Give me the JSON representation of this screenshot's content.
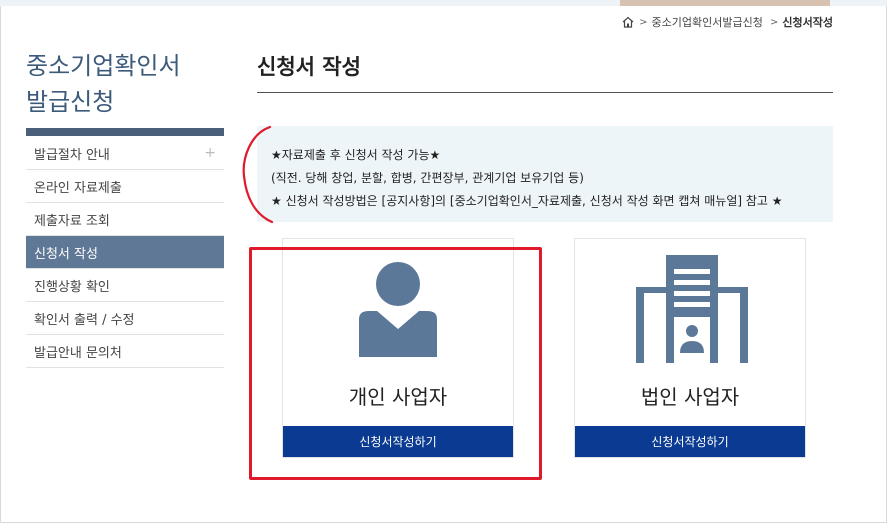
{
  "breadcrumb": {
    "items": [
      "중소기업확인서발급신청",
      "신청서작성"
    ]
  },
  "sidebar": {
    "title_line1": "중소기업확인서",
    "title_line2": "발급신청",
    "items": [
      {
        "label": "발급절차 안내",
        "expand": "+"
      },
      {
        "label": "온라인 자료제출"
      },
      {
        "label": "제출자료 조회"
      },
      {
        "label": "신청서 작성",
        "active": true
      },
      {
        "label": "진행상황 확인"
      },
      {
        "label": "확인서 출력 / 수정"
      },
      {
        "label": "발급안내 문의처"
      }
    ]
  },
  "main": {
    "title": "신청서 작성",
    "notice": {
      "line1": "★자료제출 후 신청서 작성 가능★",
      "line2": "(직전. 당해 창업, 분할, 합병, 간편장부, 관계기업 보유기업 등)",
      "line3": "★ 신청서 작성방법은 [공지사항]의 [중소기업확인서_자료제출, 신청서 작성 화면 캡쳐 매뉴얼] 참고 ★"
    },
    "cards": [
      {
        "label": "개인 사업자",
        "button": "신청서작성하기",
        "icon": "person-icon"
      },
      {
        "label": "법인 사업자",
        "button": "신청서작성하기",
        "icon": "building-icon"
      }
    ]
  },
  "colors": {
    "accent_navy": "#0a3a91",
    "sidebar_active": "#5f7896",
    "icon_slate": "#5b7898",
    "highlight_red": "#e0192b"
  }
}
